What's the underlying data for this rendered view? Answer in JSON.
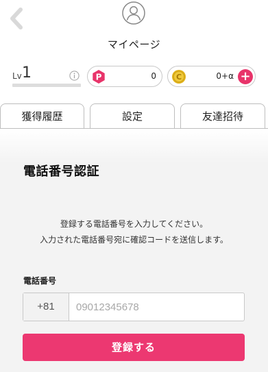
{
  "header": {
    "title": "マイページ"
  },
  "level": {
    "prefix": "Lv",
    "value": "1",
    "progress": 0
  },
  "points": {
    "p_icon_letter": "P",
    "p_value": "0",
    "c_icon_letter": "C",
    "c_value": "0+α",
    "plus_label": "+"
  },
  "tabs": [
    {
      "label": "獲得履歴"
    },
    {
      "label": "設定"
    },
    {
      "label": "友達招待"
    }
  ],
  "main": {
    "section_title": "電話番号認証",
    "description_line1": "登録する電話番号を入力してください。",
    "description_line2": "入力された電話番号宛に確認コードを送信します。",
    "field_label": "電話番号",
    "country_code": "+81",
    "phone_placeholder": "09012345678",
    "phone_value": "",
    "submit_label": "登録する"
  },
  "colors": {
    "accent": "#ec3871",
    "p_icon": "#e8346a",
    "c_icon": "#e0b21a"
  },
  "icons": {
    "back": "chevron-left-icon",
    "avatar": "user-icon",
    "info": "info-icon",
    "p_point": "p-point-icon",
    "c_coin": "c-coin-icon",
    "plus": "plus-icon"
  }
}
